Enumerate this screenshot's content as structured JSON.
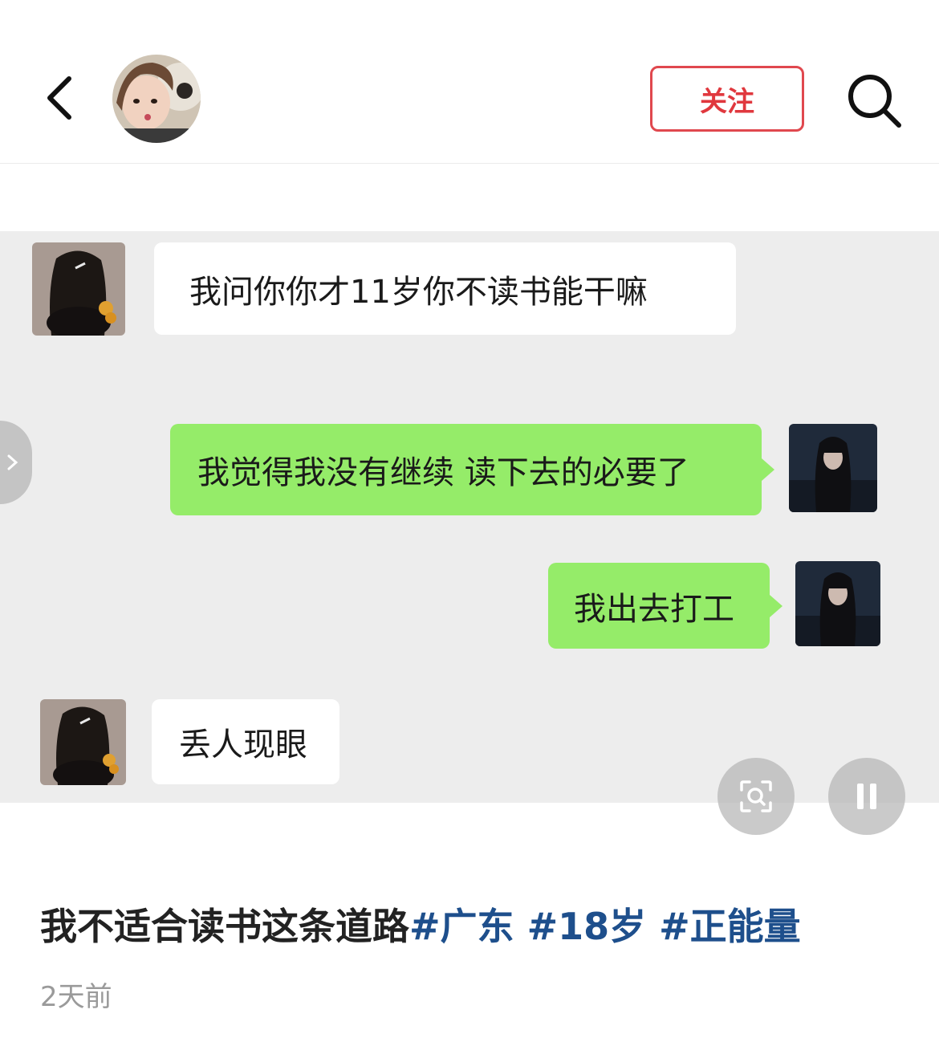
{
  "header": {
    "author_name": "",
    "follow_label": "关注",
    "icons": {
      "back": "chevron-left-icon",
      "search": "search-icon"
    }
  },
  "chat": {
    "messages": [
      {
        "side": "left",
        "text": "我问你你才11岁你不读书能干嘛"
      },
      {
        "side": "right",
        "text": "我觉得我没有继续 读下去的必要了"
      },
      {
        "side": "right",
        "text": "我出去打工"
      },
      {
        "side": "left",
        "text": "丢人现眼"
      }
    ],
    "colors": {
      "sent_bubble": "#95ec69",
      "received_bubble": "#ffffff",
      "background": "#ededed"
    }
  },
  "overlay": {
    "icons": {
      "scan": "image-search-icon",
      "pause": "pause-icon",
      "side": "chevron-right-icon"
    }
  },
  "post": {
    "caption_text": "我不适合读书这条道路",
    "tags": [
      "#广东",
      "#18岁",
      "#正能量"
    ],
    "time": "2天前",
    "colors": {
      "accent": "#e0383e",
      "tag": "#1e4f8c"
    }
  }
}
